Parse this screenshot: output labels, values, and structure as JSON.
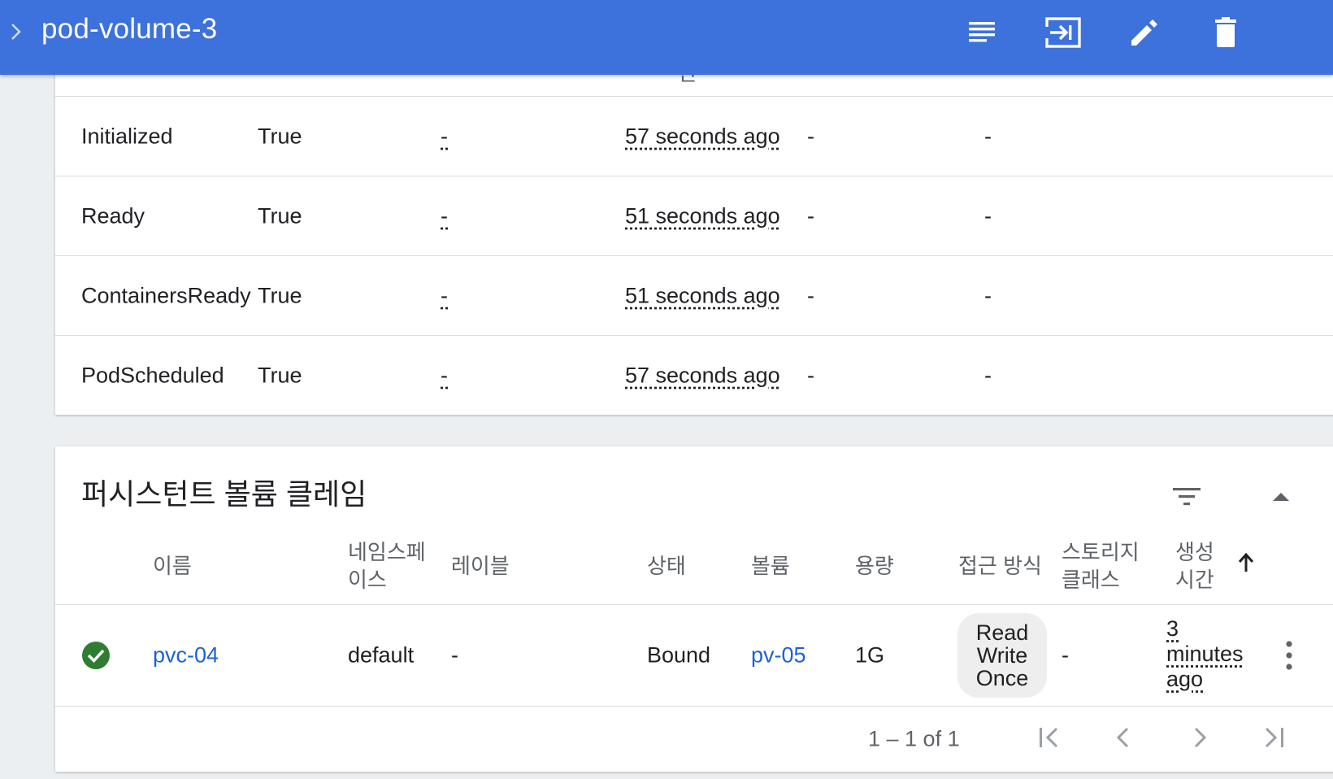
{
  "header": {
    "title": "pod-volume-3",
    "icons": [
      "chevron-right-icon",
      "logs-icon",
      "exec-icon",
      "edit-icon",
      "delete-icon"
    ]
  },
  "conditions": {
    "partial_header_glyph": "간",
    "rows": [
      {
        "type": "Initialized",
        "status": "True",
        "probe": "-",
        "time": "57 seconds ago",
        "reason": "-",
        "message": "-"
      },
      {
        "type": "Ready",
        "status": "True",
        "probe": "-",
        "time": "51 seconds ago",
        "reason": "-",
        "message": "-"
      },
      {
        "type": "ContainersReady",
        "status": "True",
        "probe": "-",
        "time": "51 seconds ago",
        "reason": "-",
        "message": "-"
      },
      {
        "type": "PodScheduled",
        "status": "True",
        "probe": "-",
        "time": "57 seconds ago",
        "reason": "-",
        "message": "-"
      }
    ]
  },
  "pvc": {
    "title": "퍼시스턴트 볼륨 클레임",
    "columns": {
      "name": "이름",
      "namespace": "네임스페이스",
      "labels": "레이블",
      "status": "상태",
      "volume": "볼륨",
      "capacity": "용량",
      "access": "접근 방식",
      "storage_class": "스토리지 클래스",
      "created": "생성 시간"
    },
    "row": {
      "name": "pvc-04",
      "namespace": "default",
      "labels": "-",
      "status": "Bound",
      "volume": "pv-05",
      "capacity": "1G",
      "access_l1": "Read",
      "access_l2": "Write",
      "access_l3": "Once",
      "storage_class": "-",
      "created_l1": "3",
      "created_l2": "minutes",
      "created_l3": "ago"
    },
    "pagination": "1 – 1 of 1",
    "colors": {
      "accent": "#3d71dc",
      "link": "#1a62d6",
      "success": "#2e7d32"
    }
  }
}
